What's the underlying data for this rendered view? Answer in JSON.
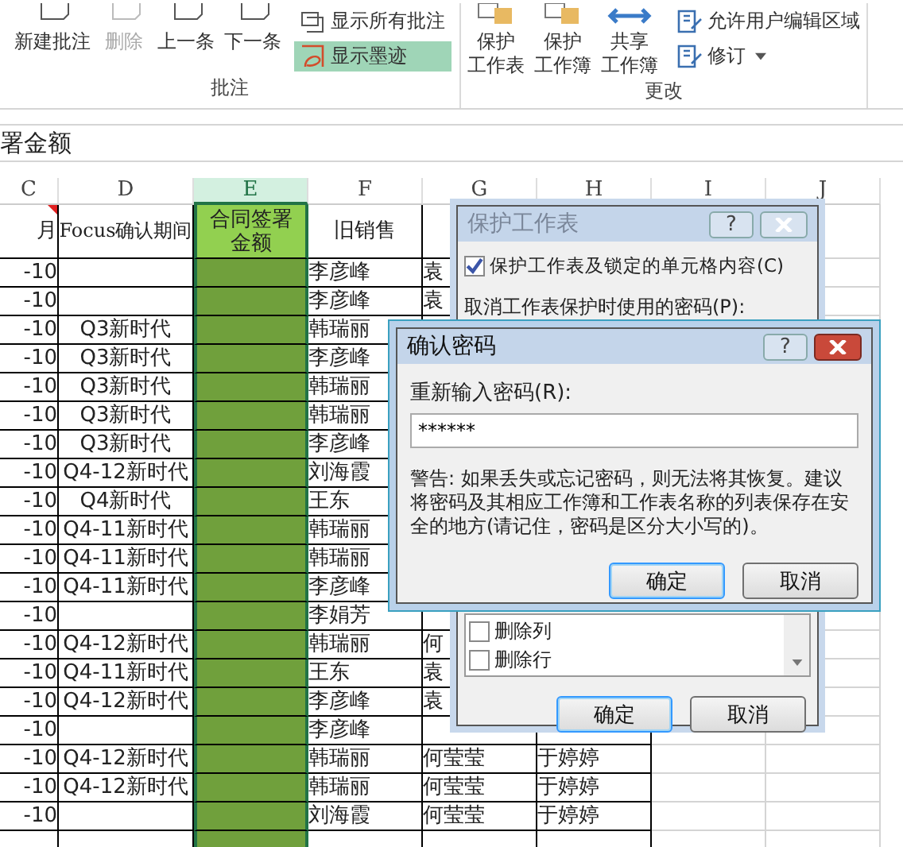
{
  "ribbon": {
    "groups": [
      {
        "label": "批注",
        "large_buttons": [
          {
            "lines": [
              "新建批注"
            ],
            "disabled": false
          },
          {
            "lines": [
              "删除"
            ],
            "disabled": true
          },
          {
            "lines": [
              "上一条"
            ],
            "disabled": false
          },
          {
            "lines": [
              "下一条"
            ],
            "disabled": false
          }
        ],
        "small_buttons": [
          {
            "label": "显示所有批注",
            "active": false,
            "dropdown": false
          },
          {
            "label": "显示墨迹",
            "active": true,
            "dropdown": false
          }
        ]
      },
      {
        "label": "更改",
        "large_buttons": [
          {
            "lines": [
              "保护",
              "工作表"
            ],
            "disabled": false
          },
          {
            "lines": [
              "保护",
              "工作簿"
            ],
            "disabled": false
          },
          {
            "lines": [
              "共享",
              "工作簿"
            ],
            "disabled": false
          }
        ],
        "small_buttons": [
          {
            "label": "允许用户编辑区域",
            "active": false,
            "dropdown": false
          },
          {
            "label": "修订",
            "active": false,
            "dropdown": true
          }
        ]
      }
    ]
  },
  "formula_bar": {
    "text": "署金额"
  },
  "sheet": {
    "columns": [
      {
        "label": "C",
        "selected": false
      },
      {
        "label": "D",
        "selected": false
      },
      {
        "label": "E",
        "selected": true
      },
      {
        "label": "F",
        "selected": false
      },
      {
        "label": "G",
        "selected": false
      },
      {
        "label": "H",
        "selected": false
      },
      {
        "label": "I",
        "selected": false
      },
      {
        "label": "J",
        "selected": false
      }
    ],
    "header": {
      "c": "月",
      "d": "Focus确认期间",
      "e": "合同签署金额",
      "f": "旧销售"
    },
    "rows": [
      {
        "c": "-10",
        "f": "李彦峰",
        "g": "袁"
      },
      {
        "c": "-10",
        "f": "李彦峰",
        "g": "袁"
      },
      {
        "c": "-10",
        "d": "Q3新时代",
        "f": "韩瑞丽"
      },
      {
        "c": "-10",
        "d": "Q3新时代",
        "f": "李彦峰"
      },
      {
        "c": "-10",
        "d": "Q3新时代",
        "f": "韩瑞丽"
      },
      {
        "c": "-10",
        "d": "Q3新时代",
        "f": "韩瑞丽"
      },
      {
        "c": "-10",
        "d": "Q3新时代",
        "f": "李彦峰"
      },
      {
        "c": "-10",
        "d": "Q4-12新时代",
        "f": "刘海霞"
      },
      {
        "c": "-10",
        "d": "Q4新时代",
        "f": "王东"
      },
      {
        "c": "-10",
        "d": "Q4-11新时代",
        "f": "韩瑞丽"
      },
      {
        "c": "-10",
        "d": "Q4-11新时代",
        "f": "韩瑞丽"
      },
      {
        "c": "-10",
        "d": "Q4-11新时代",
        "f": "李彦峰"
      },
      {
        "c": "-10",
        "f": "李娟芳"
      },
      {
        "c": "-10",
        "d": "Q4-12新时代",
        "f": "韩瑞丽",
        "g": "何"
      },
      {
        "c": "-10",
        "d": "Q4-11新时代",
        "f": "王东",
        "g": "袁"
      },
      {
        "c": "-10",
        "d": "Q4-12新时代",
        "f": "李彦峰",
        "g": "袁"
      },
      {
        "c": "-10",
        "f": "李彦峰"
      },
      {
        "c": "-10",
        "d": "Q4-12新时代",
        "f": "韩瑞丽",
        "g": "何莹莹",
        "h": "于婷婷"
      },
      {
        "c": "-10",
        "d": "Q4-12新时代",
        "f": "韩瑞丽",
        "g": "何莹莹",
        "h": "于婷婷"
      },
      {
        "c": "-10",
        "f": "刘海霞",
        "g": "何莹莹",
        "h": "于婷婷"
      },
      {}
    ]
  },
  "protect_sheet_dialog": {
    "title": "保护工作表",
    "active": false,
    "help": "?",
    "checkbox": {
      "label": "保护工作表及锁定的单元格内容(C)",
      "checked": true
    },
    "password_label": "取消工作表保护时使用的密码(P):",
    "permissions": [
      {
        "label": "删除列",
        "checked": false
      },
      {
        "label": "删除行",
        "checked": false
      }
    ],
    "buttons": [
      {
        "label": "确定",
        "default": true
      },
      {
        "label": "取消",
        "default": false
      }
    ]
  },
  "confirm_password_dialog": {
    "title": "确认密码",
    "active": true,
    "help": "?",
    "field_label": "重新输入密码(R):",
    "value": "******",
    "warning": "警告: 如果丢失或忘记密码，则无法将其恢复。建议将密码及其相应工作簿和工作表名称的列表保存在安全的地方(请记住，密码是区分大小写的)。",
    "buttons": [
      {
        "label": "确定",
        "default": true
      },
      {
        "label": "取消",
        "default": false
      }
    ]
  }
}
